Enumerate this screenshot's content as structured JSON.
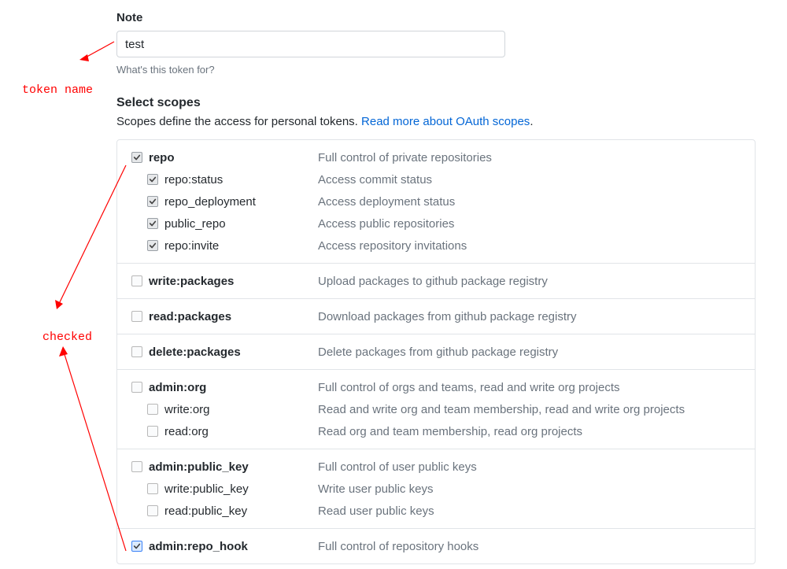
{
  "note": {
    "label": "Note",
    "value": "test",
    "hint": "What's this token for?"
  },
  "scopes": {
    "header": "Select scopes",
    "desc_prefix": "Scopes define the access for personal tokens. ",
    "link_text": "Read more about OAuth scopes",
    "link_suffix": "."
  },
  "groups": [
    {
      "name": "repo",
      "desc": "Full control of private repositories",
      "checked": true,
      "checked_style": "checked",
      "children": [
        {
          "name": "repo:status",
          "desc": "Access commit status",
          "checked": true,
          "checked_style": "checked"
        },
        {
          "name": "repo_deployment",
          "desc": "Access deployment status",
          "checked": true,
          "checked_style": "checked"
        },
        {
          "name": "public_repo",
          "desc": "Access public repositories",
          "checked": true,
          "checked_style": "checked"
        },
        {
          "name": "repo:invite",
          "desc": "Access repository invitations",
          "checked": true,
          "checked_style": "checked"
        }
      ]
    },
    {
      "name": "write:packages",
      "desc": "Upload packages to github package registry",
      "checked": false,
      "children": []
    },
    {
      "name": "read:packages",
      "desc": "Download packages from github package registry",
      "checked": false,
      "children": []
    },
    {
      "name": "delete:packages",
      "desc": "Delete packages from github package registry",
      "checked": false,
      "children": []
    },
    {
      "name": "admin:org",
      "desc": "Full control of orgs and teams, read and write org projects",
      "checked": false,
      "children": [
        {
          "name": "write:org",
          "desc": "Read and write org and team membership, read and write org projects",
          "checked": false
        },
        {
          "name": "read:org",
          "desc": "Read org and team membership, read org projects",
          "checked": false
        }
      ]
    },
    {
      "name": "admin:public_key",
      "desc": "Full control of user public keys",
      "checked": false,
      "children": [
        {
          "name": "write:public_key",
          "desc": "Write user public keys",
          "checked": false
        },
        {
          "name": "read:public_key",
          "desc": "Read user public keys",
          "checked": false
        }
      ]
    },
    {
      "name": "admin:repo_hook",
      "desc": "Full control of repository hooks",
      "checked": true,
      "checked_style": "checked-blue",
      "children": []
    }
  ],
  "annotations": {
    "token_name": "token name",
    "checked": "checked"
  }
}
